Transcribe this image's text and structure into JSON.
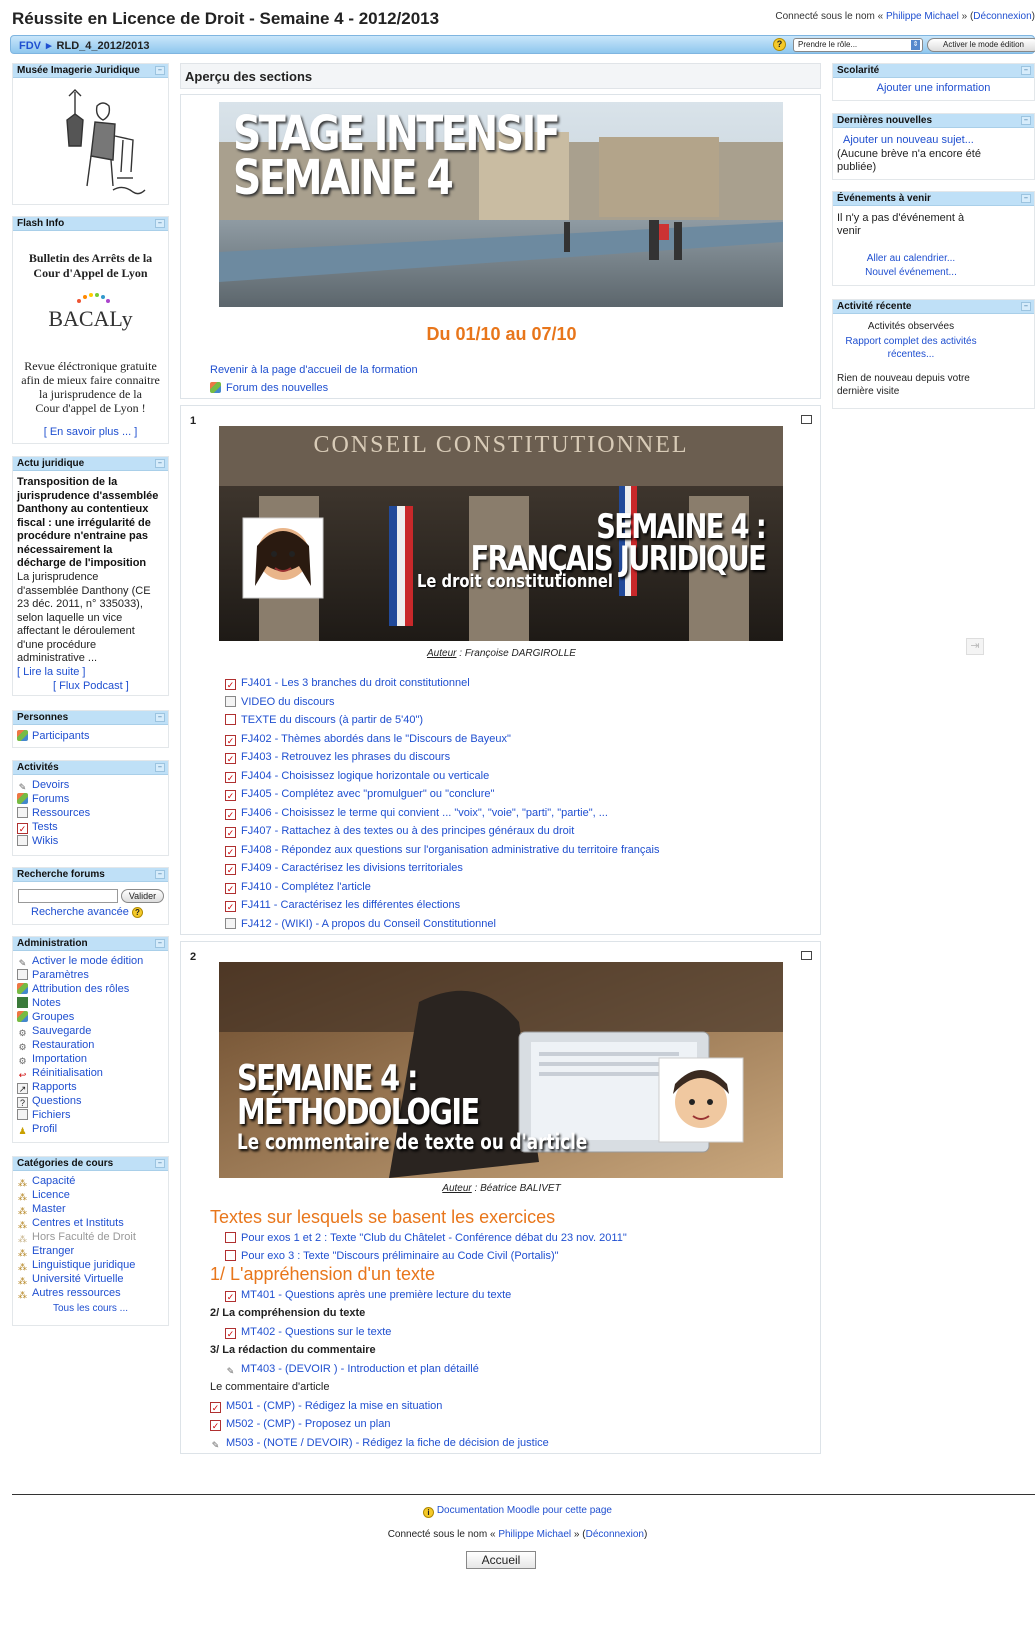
{
  "header": {
    "site_title": "Réussite en Licence de Droit - Semaine 4 - 2012/2013",
    "login_prefix": "Connecté sous le nom «",
    "user_name": "Philippe Michael",
    "login_mid": "» (",
    "logout": "Déconnexion",
    "login_suffix": ")",
    "breadcrumb": [
      "FDV",
      "RLD_4_2012/2013"
    ],
    "help_glyph": "?",
    "role_select": "Prendre le rôle...",
    "edit_button": "Activer le mode édition"
  },
  "left": {
    "musee": {
      "title": "Musée Imagerie Juridique"
    },
    "flash": {
      "title": "Flash Info",
      "bulletin_line1": "Bulletin des Arrêts de la",
      "bulletin_line2": "Cour d'Appel de Lyon",
      "logo_text": "BACALy",
      "revue_lines": [
        "Revue éléctronique gratuite",
        "afin de mieux faire connaitre",
        "la jurisprudence de la",
        "Cour d'appel de Lyon !"
      ],
      "more_link": "[ En savoir plus ... ]"
    },
    "actu": {
      "title": "Actu juridique",
      "bold_lines": [
        "Transposition de la",
        "jurisprudence d'assemblée",
        "Danthony au contentieux",
        "fiscal : une irrégularité de",
        "procédure n'entraine pas",
        "nécessairement la",
        "décharge de l'imposition"
      ],
      "body_lines": [
        "La jurisprudence",
        "d'assemblée Danthony (CE",
        "23 déc. 2011, n° 335033),",
        "selon laquelle un vice",
        "affectant le déroulement",
        "d'une procédure",
        "administrative ..."
      ],
      "read_more": "[ Lire la suite ]",
      "podcast": "[ Flux Podcast ]"
    },
    "personnes": {
      "title": "Personnes",
      "items": [
        "Participants"
      ]
    },
    "activites": {
      "title": "Activités",
      "items": [
        "Devoirs",
        "Forums",
        "Ressources",
        "Tests",
        "Wikis"
      ]
    },
    "recherche": {
      "title": "Recherche forums",
      "button": "Valider",
      "advanced": "Recherche avancée"
    },
    "admin": {
      "title": "Administration",
      "items": [
        "Activer le mode édition",
        "Paramètres",
        "Attribution des rôles",
        "Notes",
        "Groupes",
        "Sauvegarde",
        "Restauration",
        "Importation",
        "Réinitialisation",
        "Rapports",
        "Questions",
        "Fichiers",
        "Profil"
      ]
    },
    "categories": {
      "title": "Catégories de cours",
      "items": [
        "Capacité",
        "Licence",
        "Master",
        "Centres et Instituts",
        "Hors Faculté de Droit",
        "Etranger",
        "Linguistique juridique",
        "Université Virtuelle",
        "Autres ressources"
      ],
      "all": "Tous les cours ..."
    }
  },
  "center": {
    "heading": "Aperçu des sections",
    "section0": {
      "banner_line1": "STAGE INTENSIF",
      "banner_line2": "SEMAINE 4",
      "dates": "Du 01/10 au 07/10",
      "back_link": "Revenir à la page d'accueil de la formation",
      "forum": "Forum des nouvelles"
    },
    "section1": {
      "num": "1",
      "banner_top": "CONSEIL CONSTITUTIONNEL",
      "banner_l1": "SEMAINE 4 :",
      "banner_l2": "FRANÇAIS JURIDIQUE",
      "banner_l3": "Le droit constitutionnel",
      "author_label": "Auteur",
      "author_name": " : Françoise DARGIROLLE",
      "activities": [
        "FJ401 - Les 3 branches du droit constitutionnel",
        "VIDEO du discours",
        "TEXTE du discours (à partir de 5'40\")",
        "FJ402 - Thèmes abordés dans le \"Discours de Bayeux\"",
        "FJ403 - Retrouvez les phrases du discours",
        "FJ404 - Choisissez logique horizontale ou verticale",
        "FJ405 - Complétez avec \"promulguer\" ou \"conclure\"",
        "FJ406 - Choisissez le terme qui convient ... \"voix\", \"voie\", \"parti\", \"partie\", ...",
        "FJ407 - Rattachez à des textes ou à des principes généraux du droit",
        "FJ408 - Répondez aux questions sur l'organisation administrative du territoire français",
        "FJ409 - Caractérisez les divisions territoriales",
        "FJ410 - Complétez l'article",
        "FJ411 - Caractérisez les différentes élections",
        "FJ412 - (WIKI) - A propos du Conseil Constitutionnel"
      ]
    },
    "section2": {
      "num": "2",
      "banner_l1": "SEMAINE 4 :",
      "banner_l2": "MÉTHODOLOGIE",
      "banner_l3": "Le commentaire de texte ou d'article",
      "author_label": "Auteur",
      "author_name": " : Béatrice BALIVET",
      "h_textes": "Textes sur lesquels se basent les exercices",
      "texte1": "Pour exos 1 et 2 : Texte \"Club du Châtelet - Conférence débat du 23 nov. 2011\"",
      "texte2": "Pour exo 3 : Texte \"Discours préliminaire au Code Civil (Portalis)\"",
      "h_appr": "1/ L'appréhension d'un texte",
      "mt401": "MT401 - Questions après une première lecture du texte",
      "h_compr": "2/ La compréhension du texte",
      "mt402": "MT402 - Questions sur le texte",
      "h_redac": "3/ La rédaction du commentaire",
      "mt403": "MT403 - (DEVOIR ) - Introduction et plan détaillé",
      "h_comm_art": "Le commentaire d'article",
      "m501": "M501 - (CMP) - Rédigez la mise en situation",
      "m502": "M502 - (CMP) - Proposez un plan",
      "m503": "M503 - (NOTE / DEVOIR) - Rédigez la fiche de décision de justice"
    }
  },
  "right": {
    "scolarite": {
      "title": "Scolarité",
      "link": "Ajouter une information"
    },
    "news": {
      "title": "Dernières nouvelles",
      "link": "Ajouter un nouveau sujet...",
      "empty_lines": [
        "(Aucune brève n'a encore été",
        "publiée)"
      ]
    },
    "events": {
      "title": "Événements à venir",
      "empty_lines": [
        "Il n'y a pas d'événement à",
        "venir"
      ],
      "calendar": "Aller au calendrier...",
      "new_event": "Nouvel événement..."
    },
    "recent": {
      "title": "Activité récente",
      "observed": "Activités observées",
      "report_lines": [
        "Rapport complet des activités",
        "récentes..."
      ],
      "nothing_lines": [
        "Rien de nouveau depuis votre",
        "dernière visite"
      ]
    }
  },
  "footer": {
    "doc_link": "Documentation Moodle pour cette page",
    "login_prefix": "Connecté sous le nom «",
    "user_name": "Philippe Michael",
    "login_mid": "» (",
    "logout": "Déconnexion",
    "login_suffix": ")",
    "home_button": "Accueil"
  },
  "colors": {
    "accent_orange": "#e8761b",
    "link_blue": "#1f4fd0",
    "block_header": "#bfe0f7"
  }
}
